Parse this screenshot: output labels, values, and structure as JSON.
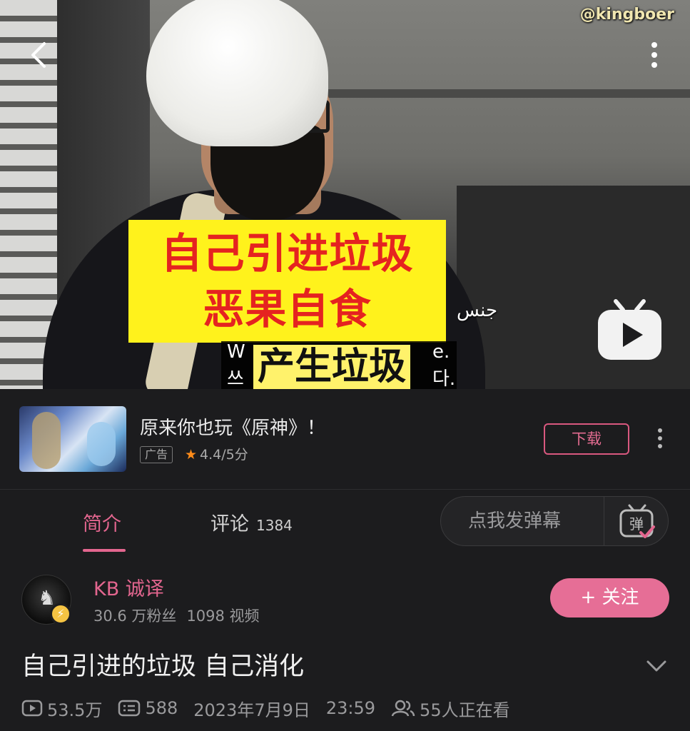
{
  "video": {
    "watermark": "@kingboer",
    "caption_line1": "自己引进垃圾",
    "caption_line2": "恶果自食",
    "subtitle_cn": "产生垃圾",
    "subtitle_arabic": "جنس",
    "subtitle_frag_w": "W",
    "subtitle_frag_e": "e.",
    "subtitle_frag_ko1": "쓰",
    "subtitle_frag_ko2": "다."
  },
  "ad": {
    "title": "原来你也玩《原神》！",
    "tag": "广告",
    "rating": "4.4/5分",
    "download_label": "下载"
  },
  "tabs": {
    "intro_label": "简介",
    "comments_label": "评论",
    "comments_count": "1384",
    "danmaku_placeholder": "点我发弹幕",
    "danmaku_icon_text": "弹"
  },
  "uploader": {
    "name": "KB 诚译",
    "fans": "30.6 万粉丝",
    "videos": "1098 视频",
    "follow_label": "+ 关注"
  },
  "video_info": {
    "title": "自己引进的垃圾 自己消化",
    "views": "53.5万",
    "danmaku_count": "588",
    "date": "2023年7月9日",
    "time": "23:59",
    "watching": "55人正在看"
  },
  "colors": {
    "accent": "#e3668f",
    "caption_bg": "#fff21c",
    "caption_text": "#e52320",
    "background": "#1c1c1e"
  },
  "icons": [
    "back-arrow-icon",
    "more-vertical-icon",
    "bilibili-tv-play-icon",
    "star-icon",
    "danmaku-toggle-icon",
    "lightning-verify-icon",
    "chevron-down-icon",
    "play-count-icon",
    "danmaku-count-icon",
    "watching-people-icon"
  ]
}
